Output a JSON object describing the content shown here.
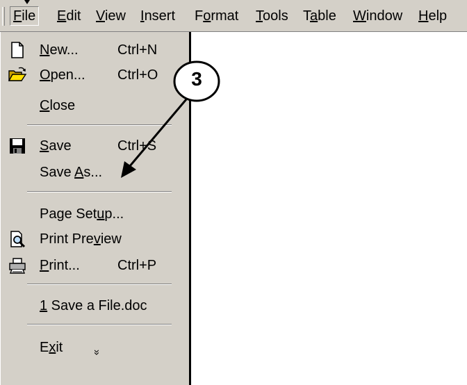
{
  "menubar": {
    "items": [
      {
        "label": "File",
        "accel": "F",
        "active": true
      },
      {
        "label": "Edit",
        "accel": "E"
      },
      {
        "label": "View",
        "accel": "V"
      },
      {
        "label": "Insert",
        "accel": "I"
      },
      {
        "label": "Format",
        "accel": "o"
      },
      {
        "label": "Tools",
        "accel": "T"
      },
      {
        "label": "Table",
        "accel": "a"
      },
      {
        "label": "Window",
        "accel": "W"
      },
      {
        "label": "Help",
        "accel": "H"
      }
    ]
  },
  "file_menu": {
    "items": [
      {
        "pre": "",
        "accel": "N",
        "post": "ew...",
        "shortcut": "Ctrl+N",
        "icon": "new-document-icon"
      },
      {
        "pre": "",
        "accel": "O",
        "post": "pen...",
        "shortcut": "Ctrl+O",
        "icon": "open-folder-icon"
      },
      {
        "pre": "",
        "accel": "C",
        "post": "lose",
        "shortcut": "",
        "icon": ""
      },
      {
        "pre": "",
        "accel": "S",
        "post": "ave",
        "shortcut": "Ctrl+S",
        "icon": "floppy-disk-icon"
      },
      {
        "pre": "Save ",
        "accel": "A",
        "post": "s...",
        "shortcut": "",
        "icon": ""
      },
      {
        "pre": "Page Set",
        "accel": "u",
        "post": "p...",
        "shortcut": "",
        "icon": ""
      },
      {
        "pre": "Print Pre",
        "accel": "v",
        "post": "iew",
        "shortcut": "",
        "icon": "print-preview-icon"
      },
      {
        "pre": "",
        "accel": "P",
        "post": "rint...",
        "shortcut": "Ctrl+P",
        "icon": "printer-icon"
      },
      {
        "pre": "",
        "accel": "1",
        "post": " Save a File.doc",
        "shortcut": "",
        "icon": ""
      },
      {
        "pre": "E",
        "accel": "x",
        "post": "it",
        "shortcut": "",
        "icon": ""
      }
    ],
    "expand_glyph": "»"
  },
  "annotation": {
    "callout_number": "3"
  }
}
